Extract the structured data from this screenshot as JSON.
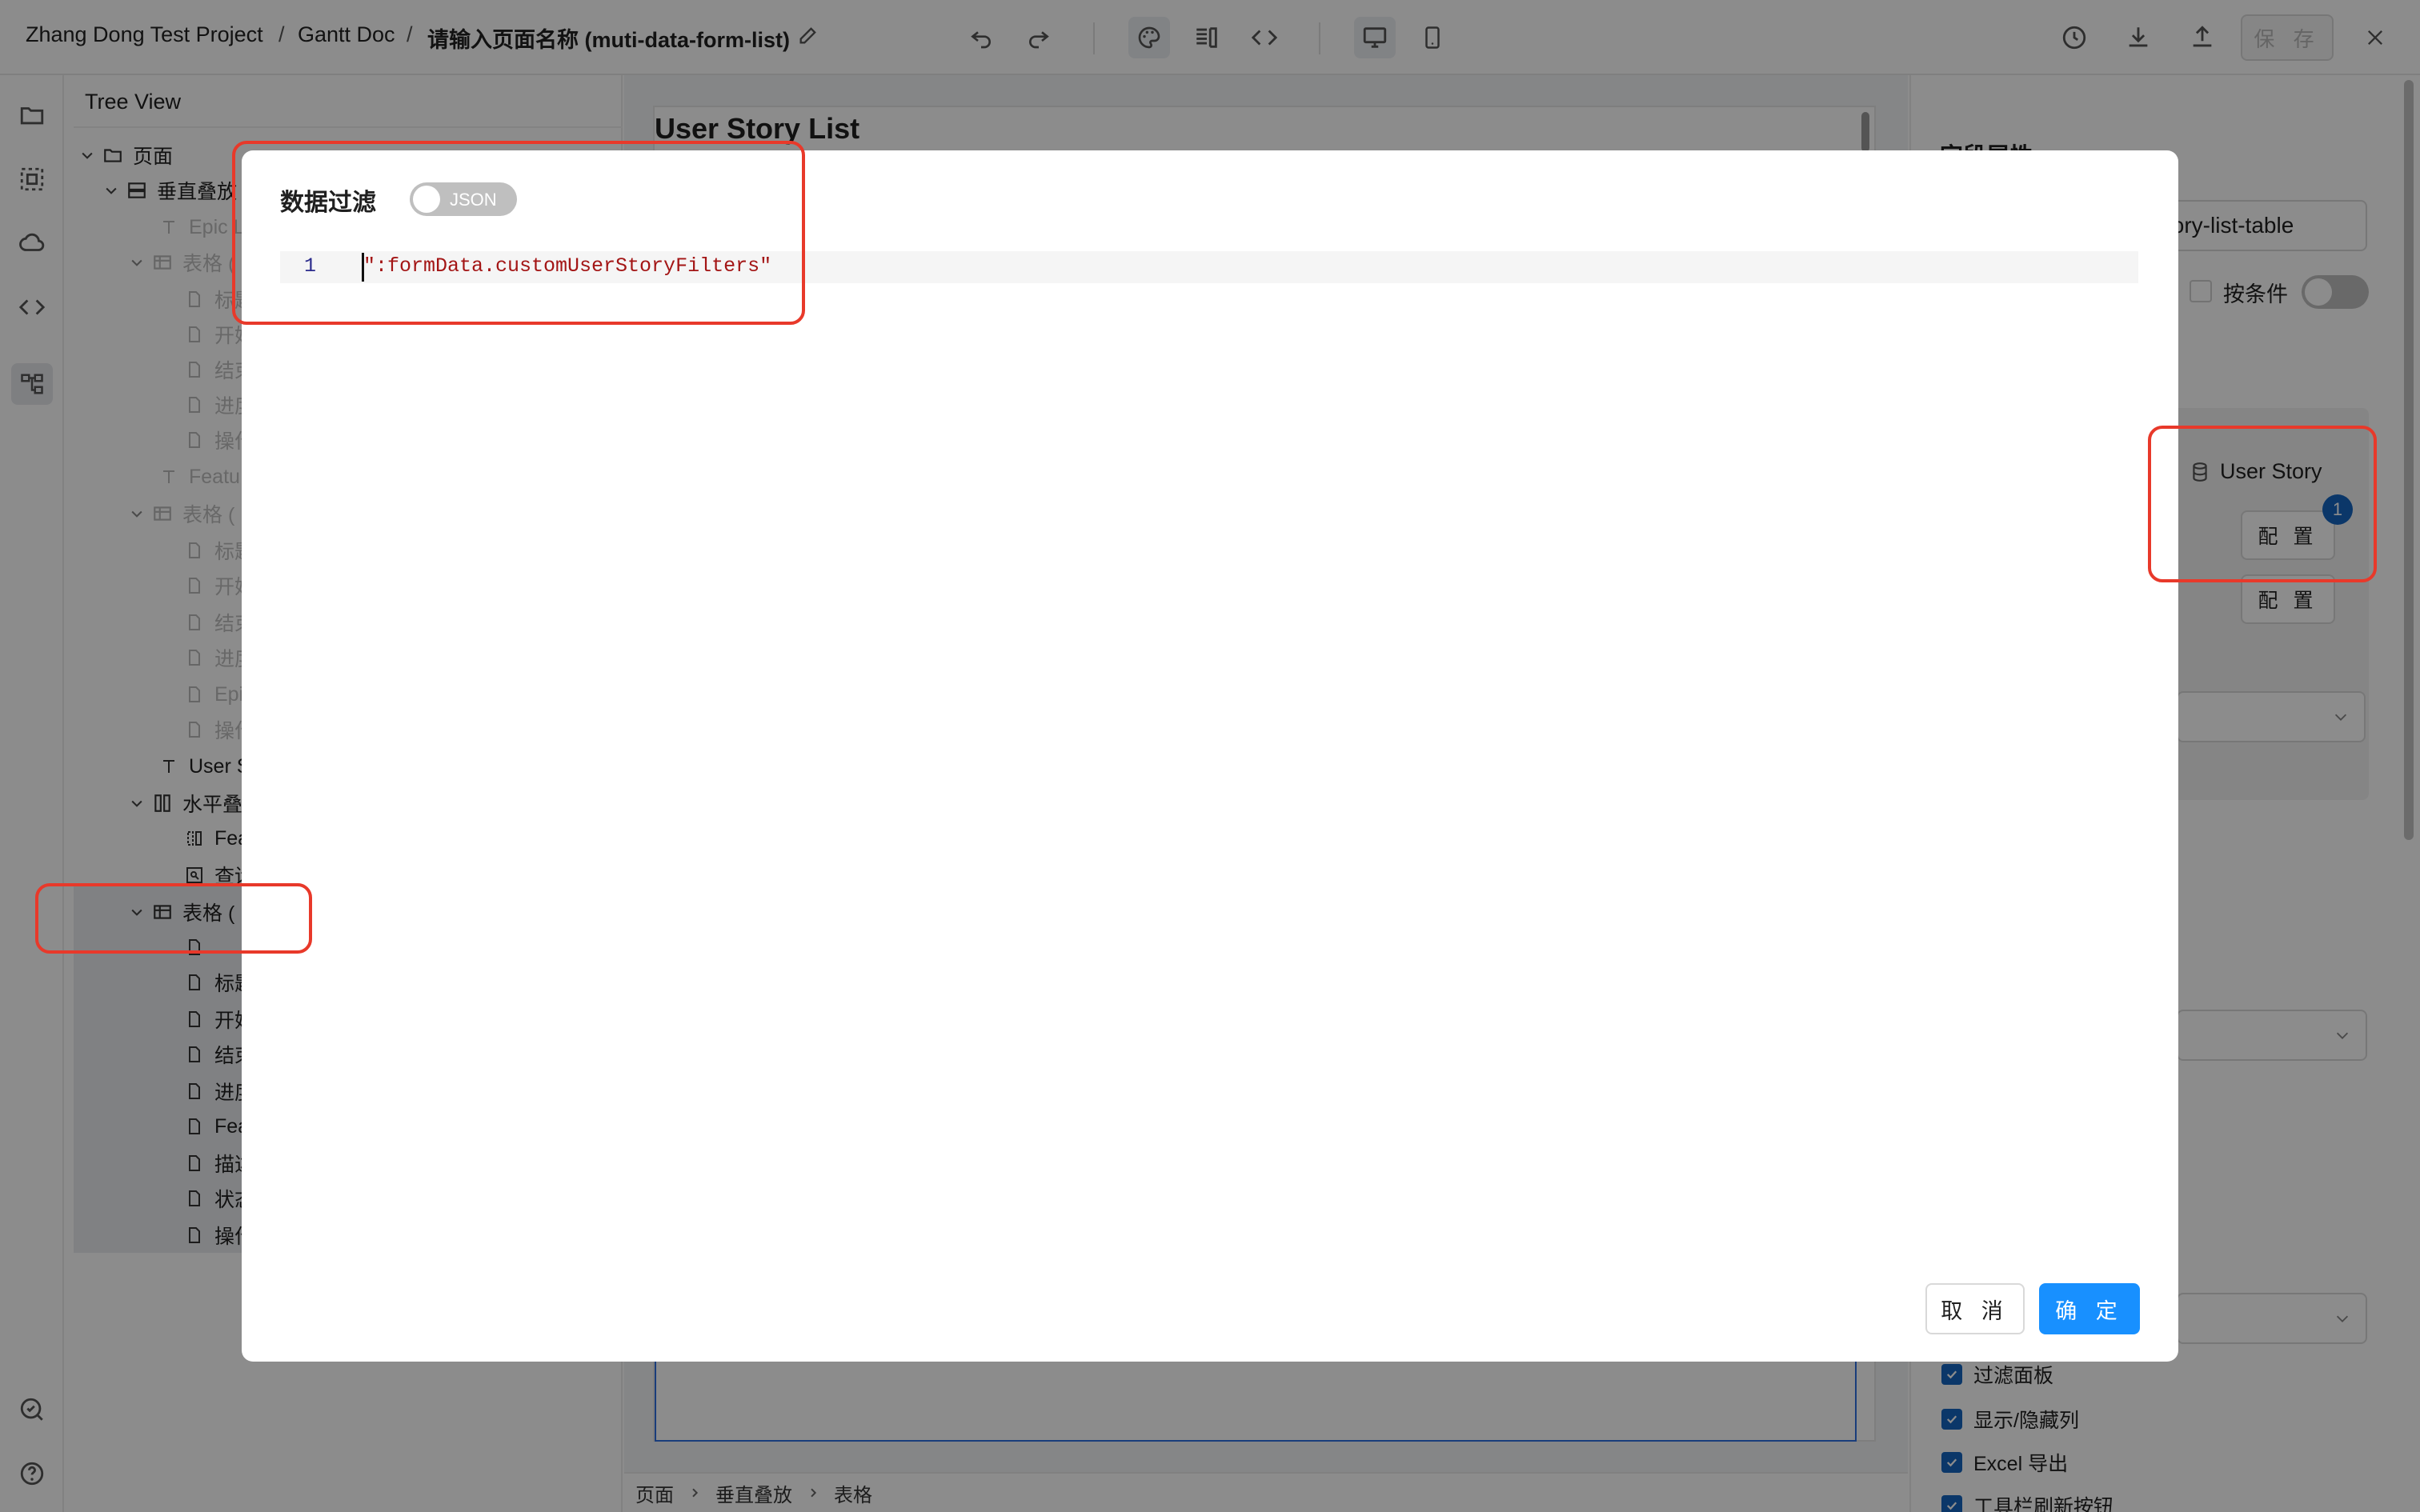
{
  "breadcrumb": {
    "project": "Zhang Dong Test Project",
    "sep1": "/",
    "doc": "Gantt Doc",
    "sep2": "/",
    "page": "请输入页面名称 (muti-data-form-list)"
  },
  "toolbar": {
    "save_label": "保 存"
  },
  "tree": {
    "title": "Tree View",
    "nodes": [
      {
        "label": "页面"
      },
      {
        "label": "垂直叠放"
      },
      {
        "label": "Epic L"
      },
      {
        "label": "表格 ("
      },
      {
        "label": "标题"
      },
      {
        "label": "开始"
      },
      {
        "label": "结束"
      },
      {
        "label": "进度"
      },
      {
        "label": "操作"
      },
      {
        "label": "Featu"
      },
      {
        "label": "表格 ("
      },
      {
        "label": "标题"
      },
      {
        "label": "开始"
      },
      {
        "label": "结束"
      },
      {
        "label": "进度"
      },
      {
        "label": "Epi"
      },
      {
        "label": "操作"
      },
      {
        "label": "User S"
      },
      {
        "label": "水平叠"
      },
      {
        "label": "Fea"
      },
      {
        "label": "查询"
      },
      {
        "label": "表格 ("
      },
      {
        "label": ""
      },
      {
        "label": "标题"
      },
      {
        "label": "开始"
      },
      {
        "label": "结束"
      },
      {
        "label": "进度"
      },
      {
        "label": "Fea"
      },
      {
        "label": "描述"
      },
      {
        "label": "状态"
      },
      {
        "label": "操作"
      }
    ]
  },
  "canvas": {
    "title": "User Story List",
    "status": {
      "crumb1": "页面",
      "crumb2": "垂直叠放",
      "crumb3": "表格"
    }
  },
  "right_panel": {
    "heading": "字段属性",
    "name_value": "tory-list-table",
    "condition_label": "按条件",
    "datasource_label": "User Story",
    "badge_count": "1",
    "config_label_1": "配 置",
    "config_label_2": "配 置",
    "checks": [
      "过滤面板",
      "显示/隐藏列",
      "Excel 导出",
      "工具栏刷新按钮"
    ]
  },
  "modal": {
    "title": "数据过滤",
    "toggle_label": "JSON",
    "line_number": "1",
    "code": "\":formData.customUserStoryFilters\"",
    "cancel_label": "取 消",
    "ok_label": "确 定"
  },
  "colors": {
    "accent": "#1890ff",
    "highlight": "#e8392a",
    "badge": "#1565c0",
    "code_string": "#a31515"
  }
}
